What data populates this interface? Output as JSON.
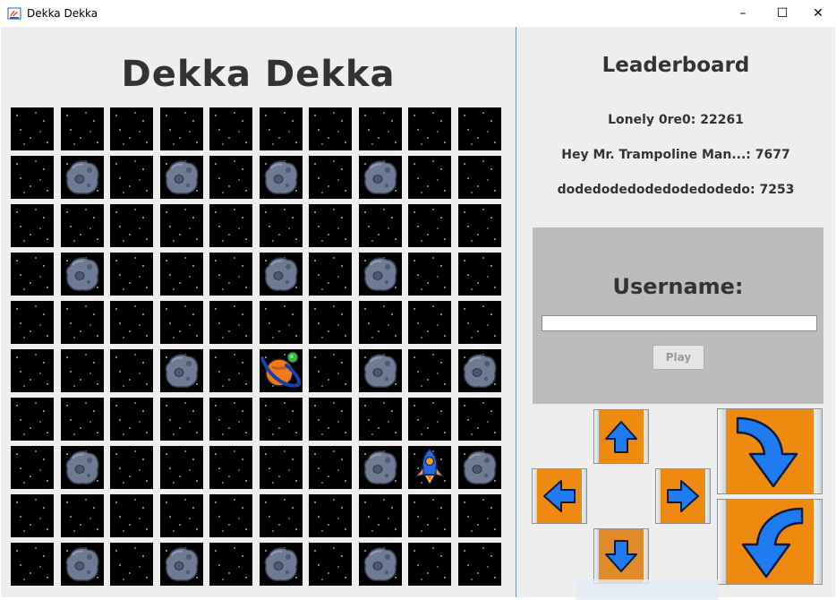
{
  "window": {
    "title": "Dekka Dekka",
    "controls": {
      "minimize": "–",
      "maximize": "☐",
      "close": "✕"
    }
  },
  "game": {
    "title": "Dekka Dekka",
    "grid": [
      "..........",
      ".A.A.A.A..",
      "..........",
      ".A...A.A..",
      "..........",
      "...A.P.A.A",
      "..........",
      ".A.....ASA",
      "..........",
      ".A.A.A.A.."
    ],
    "legend": {
      ".": "empty-space",
      "A": "asteroid",
      "P": "planet",
      "S": "rocket"
    }
  },
  "leaderboard": {
    "title": "Leaderboard",
    "entries": [
      "Lonely 0re0: 22261",
      "Hey Mr. Trampoline Man...: 7677",
      "dodedodedodedodedodedo: 7253"
    ]
  },
  "login": {
    "label": "Username:",
    "username_value": "",
    "play_label": "Play"
  },
  "controls": {
    "up": "arrow-up-icon",
    "down": "arrow-down-icon",
    "left": "arrow-left-icon",
    "right": "arrow-right-icon",
    "rotate_cw": "rotate-clockwise-icon",
    "rotate_ccw": "rotate-counterclockwise-icon",
    "accent": "#ee8a10",
    "arrow_color": "#1e7cf0"
  }
}
